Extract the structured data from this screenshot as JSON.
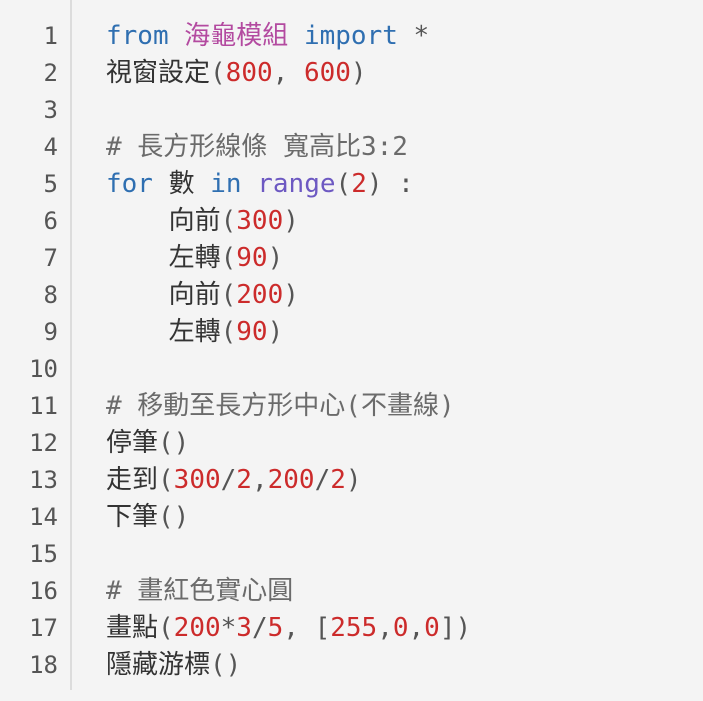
{
  "editor": {
    "lines": [
      {
        "number": "1",
        "tokens": [
          {
            "text": "from",
            "type": "kw"
          },
          {
            "text": " ",
            "type": "punc"
          },
          {
            "text": "海龜模組",
            "type": "mod"
          },
          {
            "text": " ",
            "type": "punc"
          },
          {
            "text": "import",
            "type": "kw"
          },
          {
            "text": " *",
            "type": "punc"
          }
        ]
      },
      {
        "number": "2",
        "tokens": [
          {
            "text": "視窗設定",
            "type": "plain"
          },
          {
            "text": "(",
            "type": "punc"
          },
          {
            "text": "800",
            "type": "num"
          },
          {
            "text": ", ",
            "type": "punc"
          },
          {
            "text": "600",
            "type": "num"
          },
          {
            "text": ")",
            "type": "punc"
          }
        ]
      },
      {
        "number": "3",
        "tokens": []
      },
      {
        "number": "4",
        "tokens": [
          {
            "text": "# 長方形線條 寬高比3:2",
            "type": "cmt"
          }
        ]
      },
      {
        "number": "5",
        "tokens": [
          {
            "text": "for",
            "type": "kw"
          },
          {
            "text": " 數 ",
            "type": "plain"
          },
          {
            "text": "in",
            "type": "kw"
          },
          {
            "text": " ",
            "type": "punc"
          },
          {
            "text": "range",
            "type": "fn"
          },
          {
            "text": "(",
            "type": "punc"
          },
          {
            "text": "2",
            "type": "num"
          },
          {
            "text": ") :",
            "type": "punc"
          }
        ]
      },
      {
        "number": "6",
        "tokens": [
          {
            "text": "    向前",
            "type": "plain"
          },
          {
            "text": "(",
            "type": "punc"
          },
          {
            "text": "300",
            "type": "num"
          },
          {
            "text": ")",
            "type": "punc"
          }
        ]
      },
      {
        "number": "7",
        "tokens": [
          {
            "text": "    左轉",
            "type": "plain"
          },
          {
            "text": "(",
            "type": "punc"
          },
          {
            "text": "90",
            "type": "num"
          },
          {
            "text": ")",
            "type": "punc"
          }
        ]
      },
      {
        "number": "8",
        "tokens": [
          {
            "text": "    向前",
            "type": "plain"
          },
          {
            "text": "(",
            "type": "punc"
          },
          {
            "text": "200",
            "type": "num"
          },
          {
            "text": ")",
            "type": "punc"
          }
        ]
      },
      {
        "number": "9",
        "tokens": [
          {
            "text": "    左轉",
            "type": "plain"
          },
          {
            "text": "(",
            "type": "punc"
          },
          {
            "text": "90",
            "type": "num"
          },
          {
            "text": ")",
            "type": "punc"
          }
        ]
      },
      {
        "number": "10",
        "tokens": []
      },
      {
        "number": "11",
        "tokens": [
          {
            "text": "# 移動至長方形中心(不畫線)",
            "type": "cmt"
          }
        ]
      },
      {
        "number": "12",
        "tokens": [
          {
            "text": "停筆",
            "type": "plain"
          },
          {
            "text": "()",
            "type": "punc"
          }
        ]
      },
      {
        "number": "13",
        "tokens": [
          {
            "text": "走到",
            "type": "plain"
          },
          {
            "text": "(",
            "type": "punc"
          },
          {
            "text": "300",
            "type": "num"
          },
          {
            "text": "/",
            "type": "punc"
          },
          {
            "text": "2",
            "type": "num"
          },
          {
            "text": ",",
            "type": "punc"
          },
          {
            "text": "200",
            "type": "num"
          },
          {
            "text": "/",
            "type": "punc"
          },
          {
            "text": "2",
            "type": "num"
          },
          {
            "text": ")",
            "type": "punc"
          }
        ]
      },
      {
        "number": "14",
        "tokens": [
          {
            "text": "下筆",
            "type": "plain"
          },
          {
            "text": "()",
            "type": "punc"
          }
        ]
      },
      {
        "number": "15",
        "tokens": []
      },
      {
        "number": "16",
        "tokens": [
          {
            "text": "# 畫紅色實心圓",
            "type": "cmt"
          }
        ]
      },
      {
        "number": "17",
        "tokens": [
          {
            "text": "畫點",
            "type": "plain"
          },
          {
            "text": "(",
            "type": "punc"
          },
          {
            "text": "200",
            "type": "num"
          },
          {
            "text": "*",
            "type": "punc"
          },
          {
            "text": "3",
            "type": "num"
          },
          {
            "text": "/",
            "type": "punc"
          },
          {
            "text": "5",
            "type": "num"
          },
          {
            "text": ", [",
            "type": "punc"
          },
          {
            "text": "255",
            "type": "num"
          },
          {
            "text": ",",
            "type": "punc"
          },
          {
            "text": "0",
            "type": "num"
          },
          {
            "text": ",",
            "type": "punc"
          },
          {
            "text": "0",
            "type": "num"
          },
          {
            "text": "])",
            "type": "punc"
          }
        ]
      },
      {
        "number": "18",
        "tokens": [
          {
            "text": "隱藏游標",
            "type": "plain"
          },
          {
            "text": "()",
            "type": "punc"
          }
        ]
      }
    ]
  }
}
